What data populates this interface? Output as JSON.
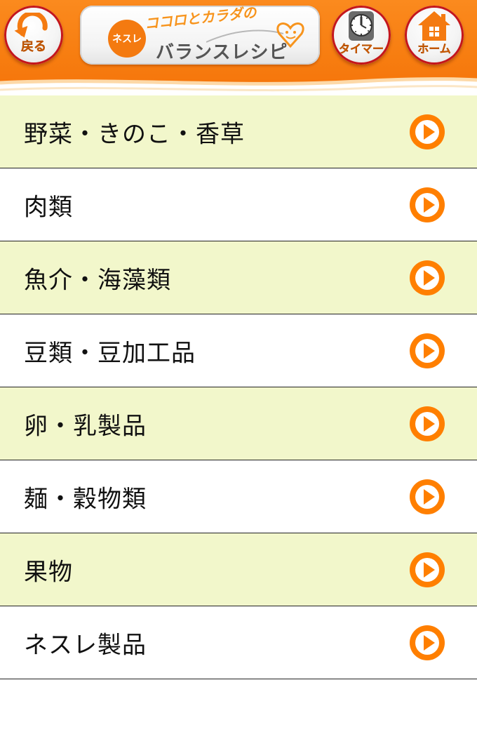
{
  "header": {
    "back_label": "戻る",
    "timer_label": "タイマー",
    "home_label": "ホーム",
    "logo": {
      "brand": "ネスレ",
      "tagline": "ココロとカラダの",
      "name": "バランスレシピ"
    }
  },
  "menu": {
    "items": [
      {
        "label": "野菜・きのこ・香草",
        "icon": "arrow-right-circle-icon"
      },
      {
        "label": "肉類",
        "icon": "arrow-right-circle-icon"
      },
      {
        "label": "魚介・海藻類",
        "icon": "arrow-right-circle-icon"
      },
      {
        "label": "豆類・豆加工品",
        "icon": "arrow-right-circle-icon"
      },
      {
        "label": "卵・乳製品",
        "icon": "arrow-right-circle-icon"
      },
      {
        "label": "麺・穀物類",
        "icon": "arrow-right-circle-icon"
      },
      {
        "label": "果物",
        "icon": "arrow-right-circle-icon"
      },
      {
        "label": "ネスレ製品",
        "icon": "arrow-right-circle-icon"
      }
    ]
  },
  "colors": {
    "header_orange": "#f77d10",
    "accent_orange": "#ff7f00",
    "row_shaded": "#f2f7cb",
    "row_plain": "#ffffff",
    "divider": "#222222"
  }
}
